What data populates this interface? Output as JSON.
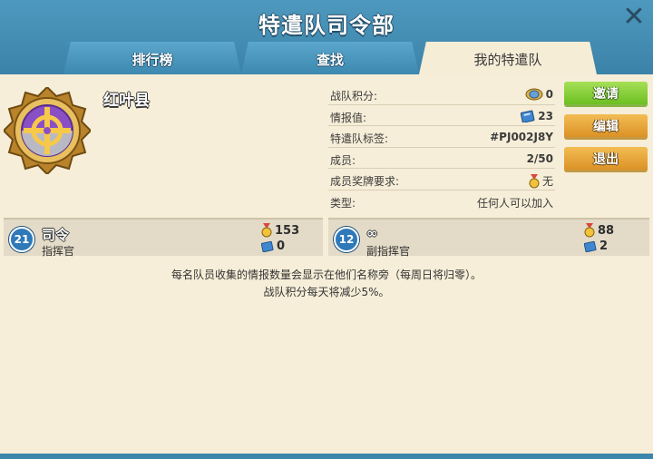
{
  "header": {
    "title": "特遣队司令部"
  },
  "tabs": [
    {
      "label": "排行榜",
      "active": false
    },
    {
      "label": "查找",
      "active": false
    },
    {
      "label": "我的特遣队",
      "active": true
    }
  ],
  "team": {
    "name": "红叶县",
    "info": [
      {
        "label": "战队积分:",
        "value": "0",
        "icon": "medal-points-icon"
      },
      {
        "label": "情报值:",
        "value": "23",
        "icon": "intel-icon"
      },
      {
        "label": "特遣队标签:",
        "value": "#PJ002J8Y",
        "icon": ""
      },
      {
        "label": "成员:",
        "value": "2/50",
        "icon": ""
      },
      {
        "label": "成员奖牌要求:",
        "value": "无",
        "icon": "medal-icon"
      },
      {
        "label": "类型:",
        "value": "任何人可以加入",
        "icon": ""
      }
    ]
  },
  "buttons": {
    "invite": "邀请",
    "edit": "编辑",
    "leave": "退出"
  },
  "members": [
    {
      "level": "21",
      "name": "司令",
      "role": "指挥官",
      "medals": "153",
      "intel": "0"
    },
    {
      "level": "12",
      "name": "∞",
      "role": "副指挥官",
      "medals": "88",
      "intel": "2"
    }
  ],
  "notes": {
    "line1": "每名队员收集的情报数量会显示在他们名称旁（每周日将归零）。",
    "line2": "战队积分每天将减少5%。"
  },
  "colors": {
    "header": "#3d86ab",
    "panel": "#f6eed8",
    "green_button": "#7ccc2c",
    "gold_button": "#e8a33a"
  }
}
